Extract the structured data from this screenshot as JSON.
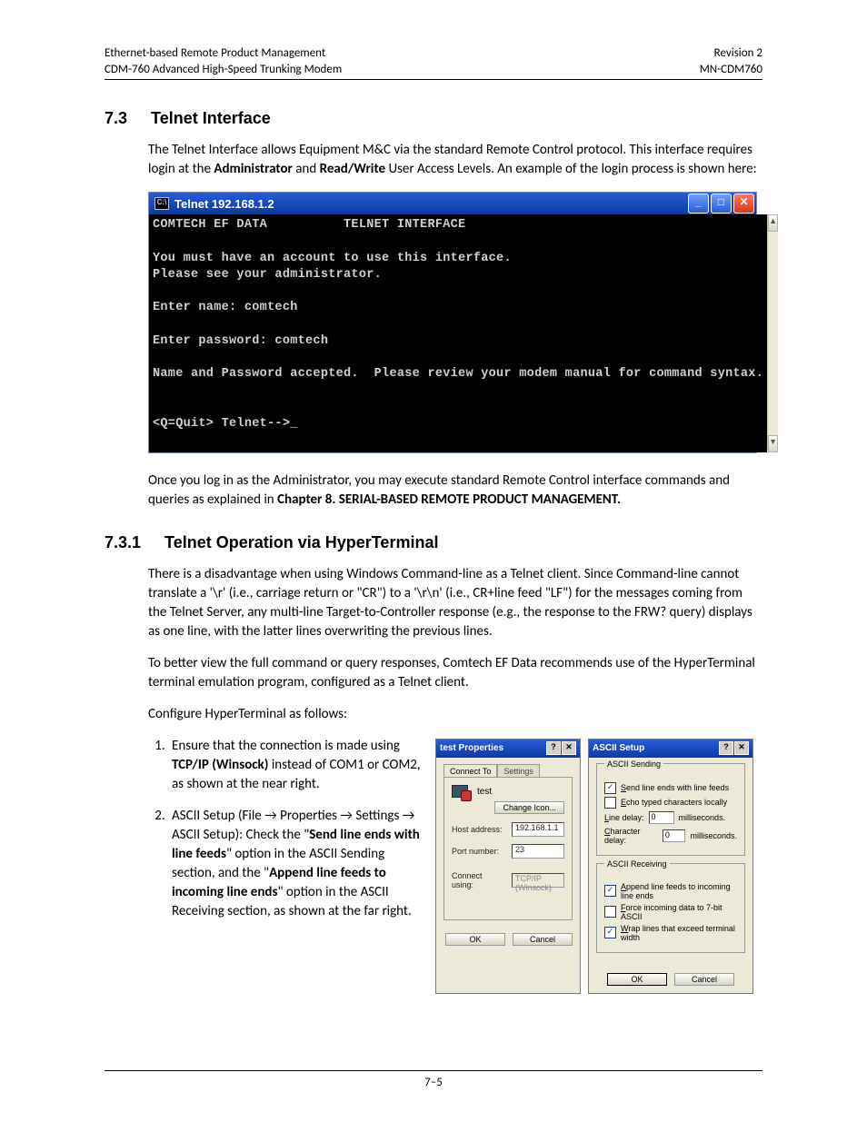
{
  "header": {
    "left1": "Ethernet-based Remote Product Management",
    "left2": "CDM-760 Advanced High-Speed Trunking Modem",
    "right1": "Revision 2",
    "right2": "MN-CDM760"
  },
  "sec73": {
    "num": "7.3",
    "title": "Telnet Interface",
    "p1_a": "The Telnet Interface allows Equipment M&C via the standard Remote Control protocol. This interface requires login at the ",
    "p1_b_bold": "Administrator",
    "p1_c": " and ",
    "p1_d_bold": "Read/Write",
    "p1_e": " User Access Levels. An example of the login process is shown here:",
    "p2_a": "Once you log in as the Administrator, you may execute standard Remote Control interface commands and queries as explained in ",
    "p2_b_bold": "Chapter 8. SERIAL-BASED REMOTE PRODUCT MANAGEMENT."
  },
  "telnet": {
    "icon_text": "C:\\",
    "title": "Telnet 192.168.1.2",
    "btn_min": "_",
    "btn_max": "□",
    "btn_close": "✕",
    "scroll_up": "▲",
    "scroll_down": "▼",
    "term": "COMTECH EF DATA          TELNET INTERFACE\n\nYou must have an account to use this interface.\nPlease see your administrator.\n\nEnter name: comtech\n\nEnter password: comtech\n\nName and Password accepted.  Please review your modem manual for command syntax.\n\n\n<Q=Quit> Telnet-->_"
  },
  "sec731": {
    "num": "7.3.1",
    "title": "Telnet Operation via HyperTerminal",
    "p1": "There is a disadvantage when using Windows Command-line as a Telnet client. Since Command-line cannot translate a '\\r' (i.e., carriage return or \"CR\") to a '\\r\\n' (i.e., CR+line feed \"LF\") for the messages coming from the Telnet Server, any multi-line Target-to-Controller response (e.g., the response to the FRW? query) displays as one line, with the latter lines overwriting the previous lines.",
    "p2": "To better view the full command or query responses, Comtech EF Data recommends use of the HyperTerminal terminal emulation program, configured as a Telnet client.",
    "p3": "Configure HyperTerminal as follows:"
  },
  "steps": {
    "s1_a": "Ensure that the connection is made using ",
    "s1_b_bold": "TCP/IP (Winsock)",
    "s1_c": " instead of COM1 or COM2, as shown at the near right.",
    "s2_a": "ASCII Setup (File → Properties → Settings → ASCII Setup): Check the \"",
    "s2_b_bold": "Send line ends with line feeds",
    "s2_c": "\" option in the ASCII Sending section, and the \"",
    "s2_d_bold": "Append line feeds to incoming line ends",
    "s2_e": "\" option in the ASCII Receiving section, as shown at the far right."
  },
  "dlg_props": {
    "title": "test Properties",
    "help": "?",
    "close": "✕",
    "tab1": "Connect To",
    "tab2": "Settings",
    "name": "test",
    "change_icon": "Change Icon...",
    "host_lbl": "Host address:",
    "host_val": "192.168.1.1",
    "port_lbl": "Port number:",
    "port_val": "23",
    "conn_lbl": "Connect using:",
    "conn_val": "TCP/IP (Winsock)",
    "ok": "OK",
    "cancel": "Cancel"
  },
  "dlg_ascii": {
    "title": "ASCII Setup",
    "help": "?",
    "close": "✕",
    "send_title": "ASCII Sending",
    "send_chk1_pre": "S",
    "send_chk1_rest": "end line ends with line feeds",
    "send_chk2_pre": "E",
    "send_chk2_rest": "cho typed characters locally",
    "line_delay_pre": "L",
    "line_delay_rest": "ine delay:",
    "char_delay_pre": "C",
    "char_delay_rest": "haracter delay:",
    "delay_val": "0",
    "ms": "milliseconds.",
    "recv_title": "ASCII Receiving",
    "recv_chk1_pre": "A",
    "recv_chk1_rest": "ppend line feeds to incoming line ends",
    "recv_chk2_pre": "F",
    "recv_chk2_rest": "orce incoming data to 7-bit ASCII",
    "recv_chk3_pre": "W",
    "recv_chk3_rest": "rap lines that exceed terminal width",
    "ok": "OK",
    "cancel": "Cancel"
  },
  "check_mark": "✓",
  "page_number": "7–5"
}
